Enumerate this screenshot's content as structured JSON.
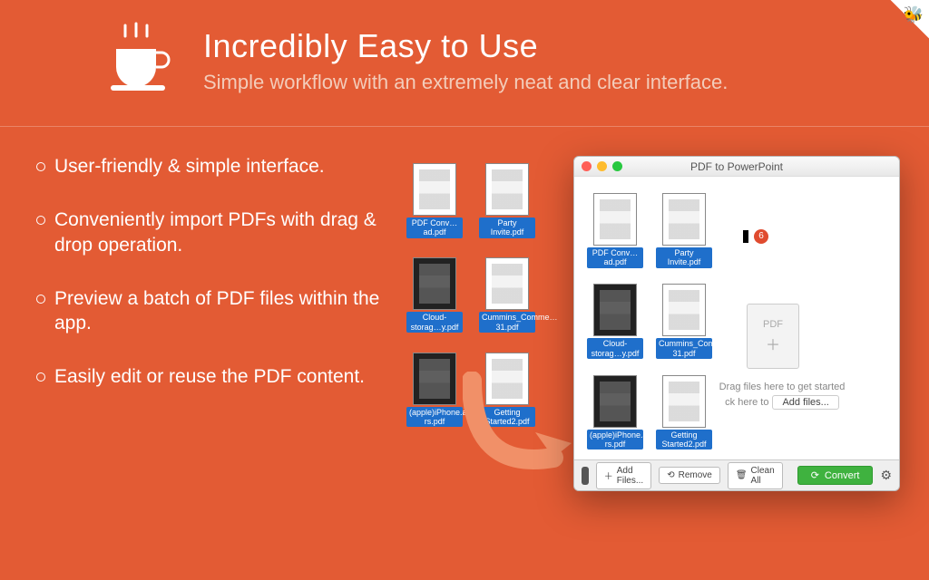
{
  "header": {
    "title": "Incredibly Easy to Use",
    "subtitle": "Simple workflow with an extremely neat and clear interface."
  },
  "bullets": [
    "User-friendly & simple interface.",
    "Conveniently import PDFs with drag & drop operation.",
    "Preview a batch of PDF files within the app.",
    "Easily edit or reuse the PDF content."
  ],
  "files": [
    {
      "name": "PDF Conv…ad.pdf",
      "dark": false
    },
    {
      "name": "Party Invite.pdf",
      "dark": false
    },
    {
      "name": "Cloud-storag…y.pdf",
      "dark": true
    },
    {
      "name": "Cummins_Comme…31.pdf",
      "dark": false
    },
    {
      "name": "(apple)iPhone.and…rs.pdf",
      "dark": true
    },
    {
      "name": "Getting Started2.pdf",
      "dark": false
    }
  ],
  "window": {
    "title": "PDF to PowerPoint",
    "badge": "6",
    "drop_label": "PDF",
    "hint": "Drag files here to get started",
    "hint_prefix": "ck here to",
    "add_inline": "Add files...",
    "toolbar": {
      "add": "Add Files...",
      "remove": "Remove",
      "clean": "Clean All",
      "convert": "Convert"
    }
  }
}
